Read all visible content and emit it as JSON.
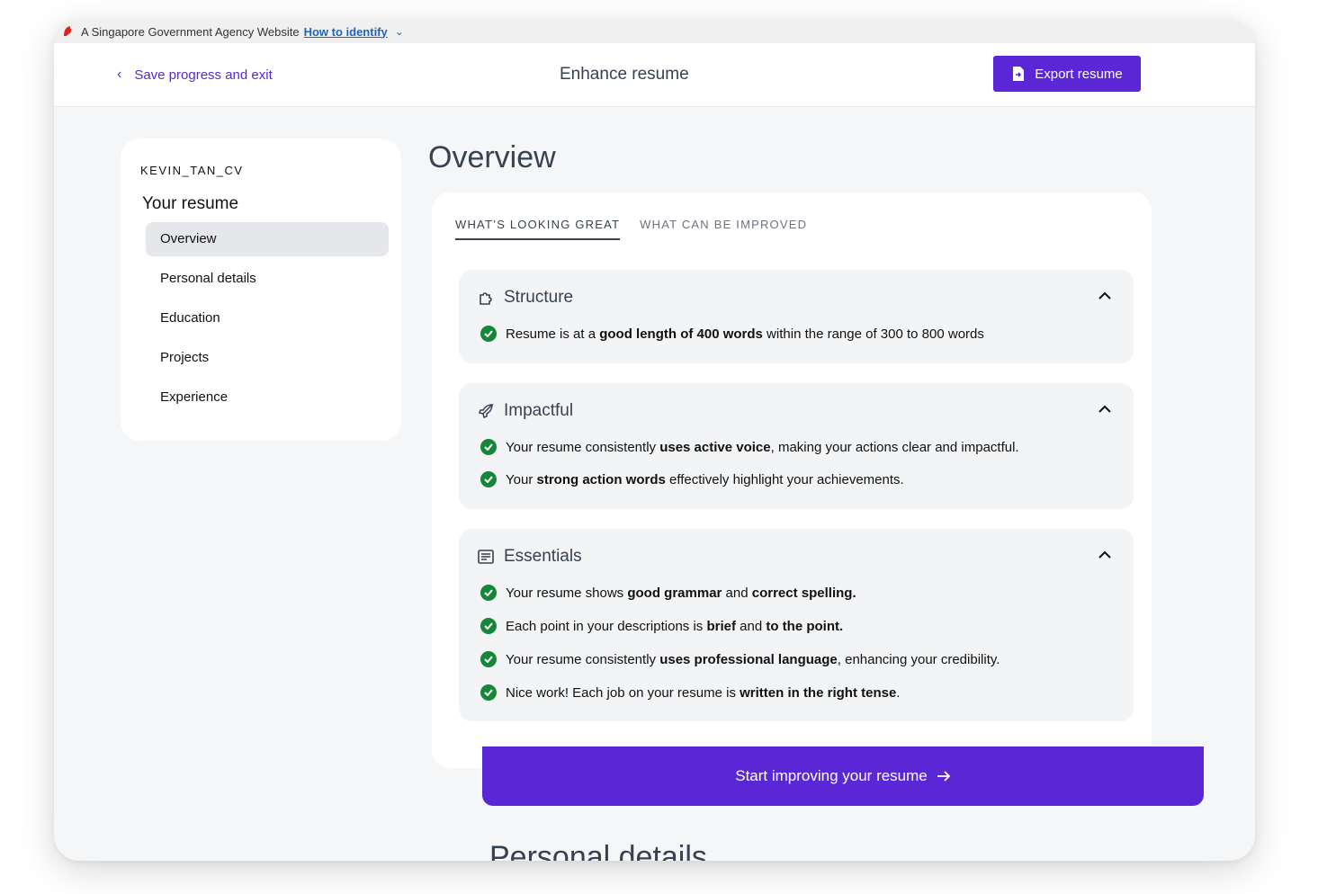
{
  "gov_banner": {
    "text": "A Singapore Government Agency Website",
    "link": "How to identify"
  },
  "header": {
    "back_label": "Save progress and exit",
    "title": "Enhance resume",
    "export_label": "Export resume"
  },
  "sidebar": {
    "file_name": "KEVIN_TAN_CV",
    "heading": "Your resume",
    "items": [
      {
        "label": "Overview",
        "active": true
      },
      {
        "label": "Personal details"
      },
      {
        "label": "Education"
      },
      {
        "label": "Projects"
      },
      {
        "label": "Experience"
      }
    ]
  },
  "main": {
    "title": "Overview",
    "tabs": [
      {
        "label": "WHAT’S LOOKING GREAT",
        "active": true
      },
      {
        "label": "WHAT CAN BE IMPROVED"
      }
    ],
    "sections": {
      "structure": {
        "title": "Structure",
        "items": [
          {
            "pre": "Resume is at a ",
            "bold": "good length of 400 words",
            "post": " within the range of 300 to 800 words"
          }
        ]
      },
      "impactful": {
        "title": "Impactful",
        "items": [
          {
            "pre": "Your resume consistently ",
            "bold": "uses active voice",
            "post": ", making your actions clear and impactful."
          },
          {
            "pre": "Your ",
            "bold": "strong action words",
            "post": " effectively highlight your achievements."
          }
        ]
      },
      "essentials": {
        "title": "Essentials",
        "items": [
          {
            "pre": "Your resume shows ",
            "bold": "good grammar",
            "mid": " and ",
            "bold2": "correct spelling."
          },
          {
            "pre": "Each point in your descriptions is ",
            "bold": "brief",
            "mid": " and ",
            "bold2": "to the point."
          },
          {
            "pre": "Your resume consistently ",
            "bold": "uses professional language",
            "post": ", enhancing your credibility."
          },
          {
            "pre": "Nice work! Each job on your resume is ",
            "bold": "written in the right tense",
            "post": "."
          }
        ]
      }
    },
    "cta_label": "Start improving your resume",
    "next_section_title": "Personal details"
  },
  "colors": {
    "accent": "#5b27d6",
    "success": "#16873a",
    "gov_link": "#1a66c6"
  }
}
